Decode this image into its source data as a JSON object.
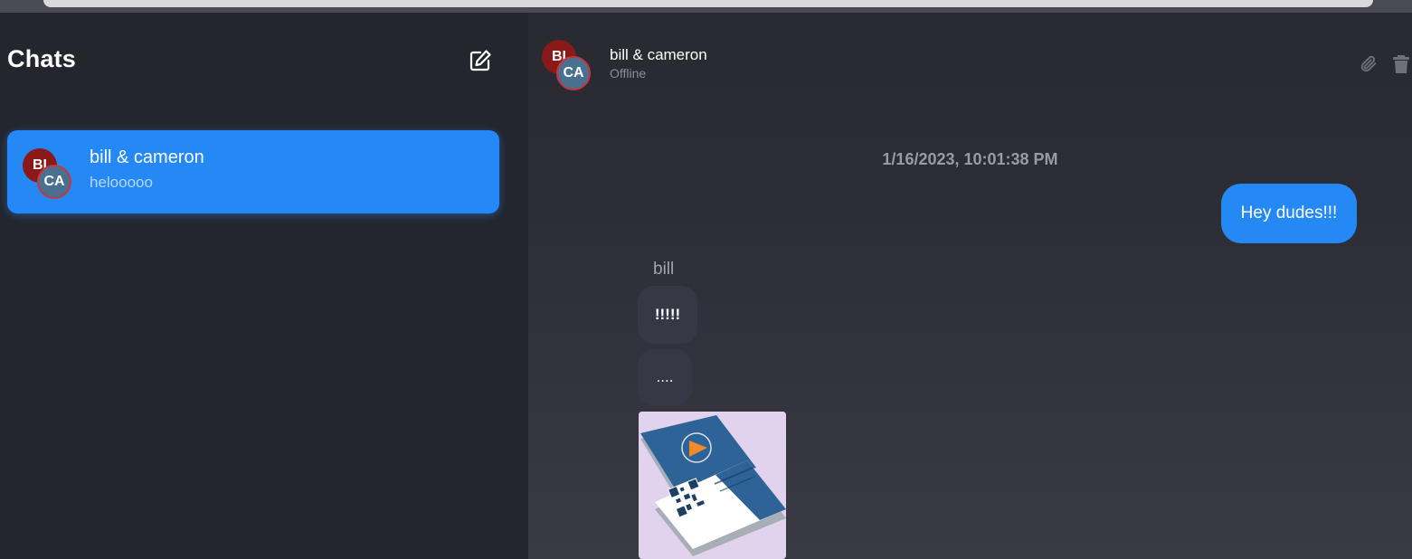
{
  "sidebar": {
    "title": "Chats",
    "new_chat_icon": "compose-icon",
    "conversations": [
      {
        "name": "bill & cameron",
        "preview": "helooooo",
        "avatars": [
          "BI",
          "CA"
        ],
        "selected": true
      }
    ]
  },
  "header": {
    "name": "bill & cameron",
    "status": "Offline",
    "avatars": [
      "BI",
      "CA"
    ],
    "actions": [
      "paperclip-icon",
      "trash-icon"
    ]
  },
  "messages": {
    "timestamp": "1/16/2023, 10:01:38 PM",
    "sent": [
      {
        "text": "Hey dudes!!!"
      }
    ],
    "received_sender": "bill",
    "received": [
      {
        "text": "!!!!!"
      },
      {
        "text": "...."
      }
    ],
    "image_message": {
      "kind": "photo",
      "subject": "business cards with QR code"
    }
  },
  "colors": {
    "accent": "#2589f5",
    "background": "#24252d",
    "bubble_received": "#363845",
    "avatar_bill": "#8a1a1a",
    "avatar_cameron": "#49708f"
  }
}
